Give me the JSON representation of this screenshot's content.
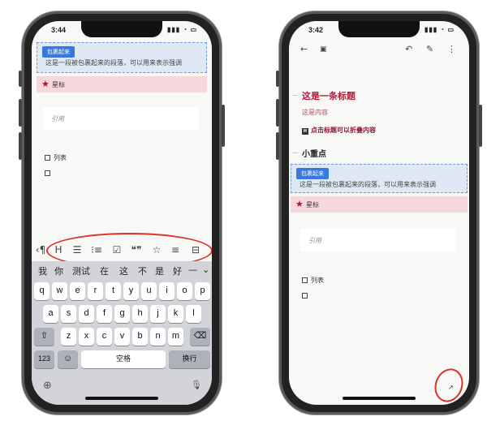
{
  "left_phone": {
    "status": {
      "time": "3:44",
      "icons": "▮▮▮ ◔ ▭"
    },
    "wrap_block": {
      "tag": "包裹起来",
      "text": "这是一段被包裹起来的段落，可以用来表示强调"
    },
    "star": {
      "icon": "star-icon",
      "label": "星标"
    },
    "quote": {
      "placeholder": "引用"
    },
    "checklist": [
      {
        "label": "列表"
      },
      {
        "label": ""
      }
    ],
    "toolbar": {
      "items": [
        {
          "icon": "chevron-left-icon",
          "glyph": "‹¶"
        },
        {
          "icon": "heading-icon",
          "glyph": "H"
        },
        {
          "icon": "bullet-list-icon",
          "glyph": "☰"
        },
        {
          "icon": "numbered-list-icon",
          "glyph": "⁝≡"
        },
        {
          "icon": "checkbox-icon",
          "glyph": "☑"
        },
        {
          "icon": "quote-icon",
          "glyph": "❝❞"
        },
        {
          "icon": "star-icon",
          "glyph": "☆"
        },
        {
          "icon": "more-icon",
          "glyph": "≡"
        },
        {
          "icon": "overflow-icon",
          "glyph": "⊟"
        }
      ]
    },
    "keyboard": {
      "candidates": [
        "我",
        "你",
        "测试",
        "在",
        "这",
        "不",
        "是",
        "好",
        "—",
        "⌄"
      ],
      "row1": [
        "q",
        "w",
        "e",
        "r",
        "t",
        "y",
        "u",
        "i",
        "o",
        "p"
      ],
      "row2": [
        "a",
        "s",
        "d",
        "f",
        "g",
        "h",
        "j",
        "k",
        "l"
      ],
      "row3": [
        "z",
        "x",
        "c",
        "v",
        "b",
        "n",
        "m"
      ],
      "shift": "⇧",
      "backspace": "⌫",
      "num": "123",
      "emoji": "☺",
      "space": "空格",
      "return": "换行",
      "globe": "⊕",
      "mic": "🎙"
    }
  },
  "right_phone": {
    "status": {
      "time": "3:42",
      "icons": "▮▮▮ ◔ ▭"
    },
    "app_bar": {
      "back": "←",
      "save": "▣",
      "undo": "↶",
      "edit": "✎",
      "more": "⋮"
    },
    "heading1": "这是一条标题",
    "heading_gutter": "一",
    "content": "这是内容",
    "collapse_hint_badge": "H",
    "collapse_hint": "点击标题可以折叠内容",
    "heading2": "小重点",
    "wrap_block": {
      "tag": "包裹起来",
      "text": "这是一段被包裹起来的段落，可以用来表示强调"
    },
    "star": {
      "icon": "star-icon",
      "label": "星标"
    },
    "quote": {
      "placeholder": "引用"
    },
    "checklist": [
      {
        "label": "列表"
      },
      {
        "label": ""
      }
    ],
    "fab_icon": "↗"
  },
  "colors": {
    "accent_blue": "#3a78e0",
    "heading_red": "#b01c3a",
    "annotation_red": "#d93226",
    "star_row_bg": "#f5d7dc",
    "wrap_bg": "#dfe9f5"
  }
}
